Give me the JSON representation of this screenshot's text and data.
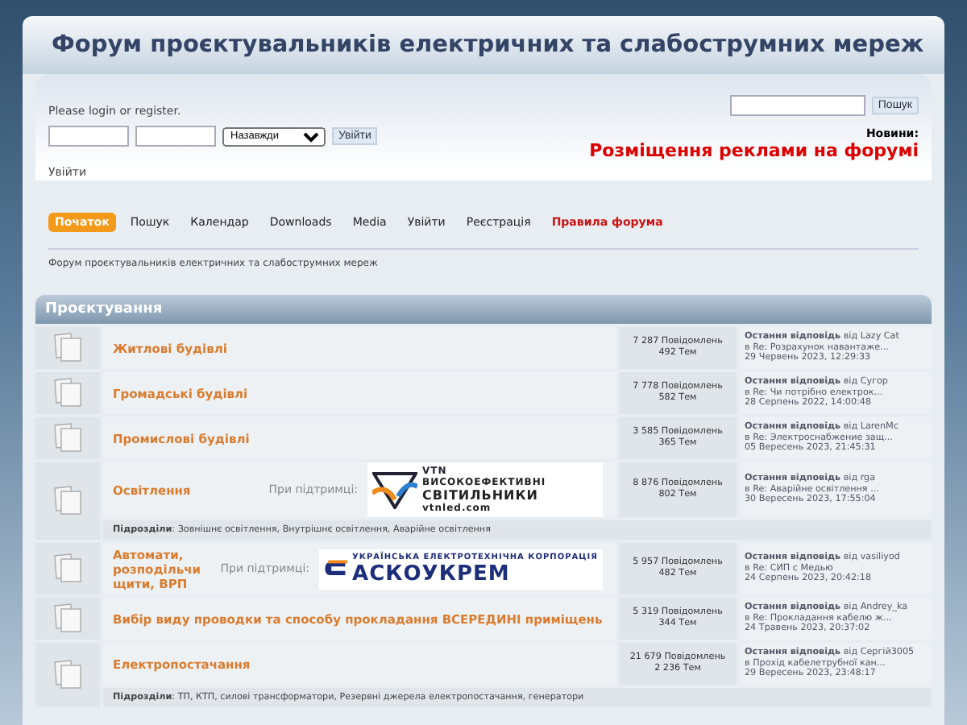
{
  "header": {
    "title": "Форум проєктувальників електричних та слабострумних мереж"
  },
  "login": {
    "prompt": "Please login or register.",
    "duration": "Назавжди",
    "button": "Увійти",
    "link": "Увійти"
  },
  "search": {
    "button": "Пошук"
  },
  "news": {
    "label": "Новини:",
    "text": "Розміщення реклами на форумі"
  },
  "menu": [
    {
      "label": "Початок",
      "selected": true,
      "kind": "normal"
    },
    {
      "label": "Пошук",
      "selected": false,
      "kind": "normal"
    },
    {
      "label": "Календар",
      "selected": false,
      "kind": "normal"
    },
    {
      "label": "Downloads",
      "selected": false,
      "kind": "normal"
    },
    {
      "label": "Media",
      "selected": false,
      "kind": "normal"
    },
    {
      "label": "Увійти",
      "selected": false,
      "kind": "normal"
    },
    {
      "label": "Реєстрація",
      "selected": false,
      "kind": "normal"
    },
    {
      "label": "Правила форума",
      "selected": false,
      "kind": "highlight"
    }
  ],
  "breadcrumb": "Форум проєктувальників електричних та слабострумних мереж",
  "category": {
    "title": "Проєктування",
    "boards": [
      {
        "name": "Житлові будівлі",
        "posts": "7 287 Повідомлень",
        "topics": "492 Тем",
        "last": {
          "by": "**Остання відповідь** від Lazy Cat",
          "topic": "в Re: Розрахунок навантаже...",
          "date": "29 Червень 2023, 12:29:33"
        }
      },
      {
        "name": "Громадські будівлі",
        "posts": "7 778 Повідомлень",
        "topics": "582 Тем",
        "last": {
          "by": "**Остання відповідь** від Сугор",
          "topic": "в Re: Чи потрібно електрок...",
          "date": "28 Серпень 2022, 14:00:48"
        }
      },
      {
        "name": "Промислові будівлі",
        "posts": "3 585 Повідомлень",
        "topics": "365 Тем",
        "last": {
          "by": "**Остання відповідь** від LarenMc",
          "topic": "в Re: Электроснабжение защ...",
          "date": "05 Вересень 2023, 21:45:31"
        }
      },
      {
        "name": "Освітлення",
        "sponsor": {
          "label": "При підтримці:",
          "kind": "vtn",
          "mark": "VTN",
          "lines": [
            "ВИСОКОЕФЕКТИВНІ",
            "СВІТИЛЬНИКИ",
            "vtnled.com"
          ]
        },
        "posts": "8 876 Повідомлень",
        "topics": "802 Тем",
        "last": {
          "by": "**Остання відповідь** від rga",
          "topic": "в Re: Аварійне освітлення ...",
          "date": "30 Вересень 2023, 17:55:04"
        },
        "subboards": "**Підрозділи**: Зовнішнє освітлення, Внутрішнє освітлення, Аварійне освітлення"
      },
      {
        "name": "Автомати, розподільчи щити, ВРП",
        "sponsor": {
          "label": "При підтримці:",
          "kind": "asko",
          "lines": [
            "УКРАЇНСЬКА ЕЛЕКТРОТЕХНІЧНА КОРПОРАЦІЯ",
            "АСКОУКРЕМ"
          ]
        },
        "posts": "5 957 Повідомлень",
        "topics": "482 Тем",
        "last": {
          "by": "**Остання відповідь** від vasiliyod",
          "topic": "в Re: СИП с Медью",
          "date": "24 Серпень 2023, 20:42:18"
        }
      },
      {
        "name": "Вибір виду проводки та способу прокладання ВСЕРЕДИНІ приміщень",
        "posts": "5 319 Повідомлень",
        "topics": "344 Тем",
        "last": {
          "by": "**Остання відповідь** від Andrey_ka",
          "topic": "в Re: Прокладання кабелю ж...",
          "date": "24 Травень 2023, 20:37:02"
        }
      },
      {
        "name": "Електропостачання",
        "posts": "21 679 Повідомлень",
        "topics": "2 236 Тем",
        "last": {
          "by": "**Остання відповідь** від Сергій3005",
          "topic": "в Прохід кабелетрубної кан...",
          "date": "29 Вересень 2023, 23:48:17"
        },
        "subboards": "**Підрозділи**: ТП, КТП, силові трансформатори, Резервні джерела електропостачання, генератори"
      }
    ]
  }
}
